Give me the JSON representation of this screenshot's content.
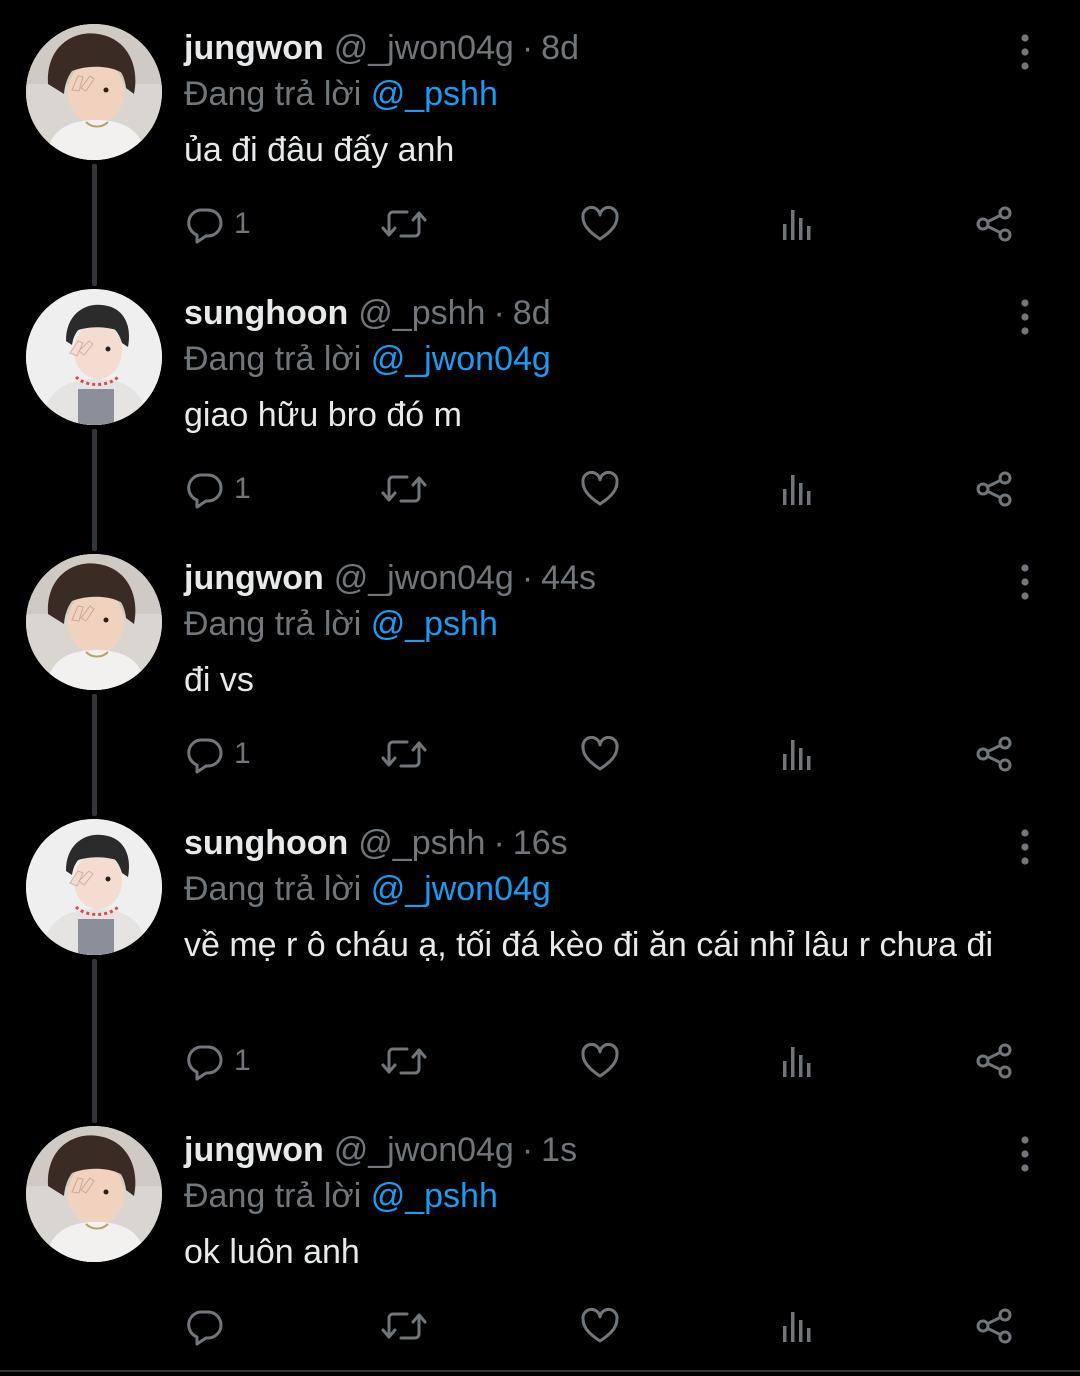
{
  "reply_prefix": "Đang trả lời",
  "colors": {
    "background": "#000000",
    "text": "#e7e9ea",
    "muted": "#71767b",
    "accent": "#1d9bf0",
    "thread_line": "#333639"
  },
  "icons": {
    "menu": "more-vertical-icon",
    "reply": "reply-icon",
    "retweet": "retweet-icon",
    "like": "heart-icon",
    "views": "views-chart-icon",
    "share": "share-icon"
  },
  "tweets": [
    {
      "name": "jungwon",
      "handle": "@_jwon04g",
      "time": "8d",
      "reply_to": "@_pshh",
      "text": "ủa đi đâu đấy anh",
      "reply_count": "1"
    },
    {
      "name": "sunghoon",
      "handle": "@_pshh",
      "time": "8d",
      "reply_to": "@_jwon04g",
      "text": "giao hữu bro đó m",
      "reply_count": "1"
    },
    {
      "name": "jungwon",
      "handle": "@_jwon04g",
      "time": "44s",
      "reply_to": "@_pshh",
      "text": "đi vs",
      "reply_count": "1"
    },
    {
      "name": "sunghoon",
      "handle": "@_pshh",
      "time": "16s",
      "reply_to": "@_jwon04g",
      "text": "về mẹ r ô cháu ạ, tối đá kèo đi ăn cái nhỉ lâu r chưa đi",
      "reply_count": "1"
    },
    {
      "name": "jungwon",
      "handle": "@_jwon04g",
      "time": "1s",
      "reply_to": "@_pshh",
      "text": "ok luôn anh",
      "reply_count": ""
    }
  ]
}
